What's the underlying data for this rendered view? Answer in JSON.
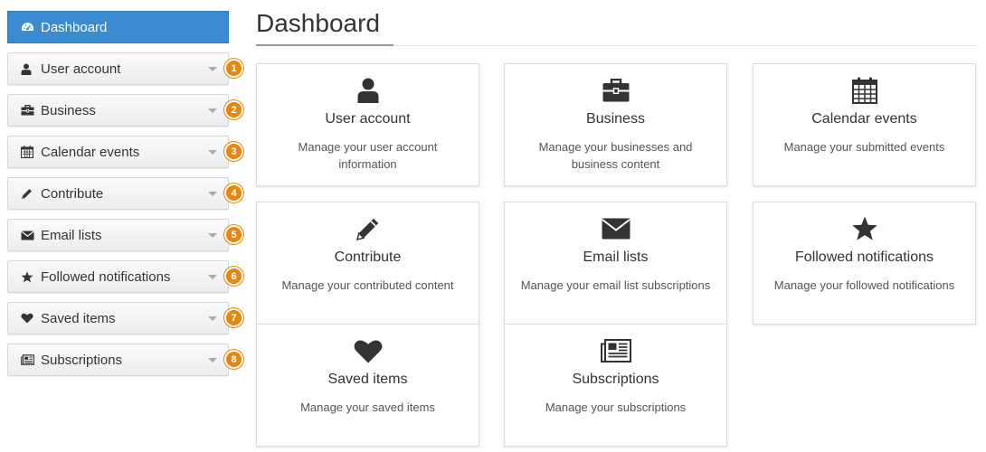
{
  "sidebar": {
    "active": {
      "label": "Dashboard",
      "icon": "dashboard-icon",
      "color": "#3a8bd0"
    },
    "items": [
      {
        "label": "User account",
        "icon": "user-icon",
        "badge": "1"
      },
      {
        "label": "Business",
        "icon": "briefcase-icon",
        "badge": "2"
      },
      {
        "label": "Calendar events",
        "icon": "calendar-icon",
        "badge": "3"
      },
      {
        "label": "Contribute",
        "icon": "pencil-icon",
        "badge": "4"
      },
      {
        "label": "Email lists",
        "icon": "envelope-icon",
        "badge": "5"
      },
      {
        "label": "Followed notifications",
        "icon": "star-icon",
        "badge": "6"
      },
      {
        "label": "Saved items",
        "icon": "heart-icon",
        "badge": "7"
      },
      {
        "label": "Subscriptions",
        "icon": "newspaper-icon",
        "badge": "8"
      }
    ],
    "badge_color": "#e8870e"
  },
  "main": {
    "title": "Dashboard",
    "cards": [
      {
        "title": "User account",
        "description": "Manage your user account information",
        "icon": "user-icon"
      },
      {
        "title": "Business",
        "description": "Manage your businesses and business content",
        "icon": "briefcase-icon"
      },
      {
        "title": "Calendar events",
        "description": "Manage your submitted events",
        "icon": "calendar-icon"
      },
      {
        "title": "Contribute",
        "description": "Manage your contributed content",
        "icon": "pencil-icon"
      },
      {
        "title": "Email lists",
        "description": "Manage your email list subscriptions",
        "icon": "envelope-icon"
      },
      {
        "title": "Followed notifications",
        "description": "Manage your followed notifications",
        "icon": "star-icon"
      },
      {
        "title": "Saved items",
        "description": "Manage your saved items",
        "icon": "heart-icon"
      },
      {
        "title": "Subscriptions",
        "description": "Manage your subscriptions",
        "icon": "newspaper-icon"
      }
    ]
  }
}
